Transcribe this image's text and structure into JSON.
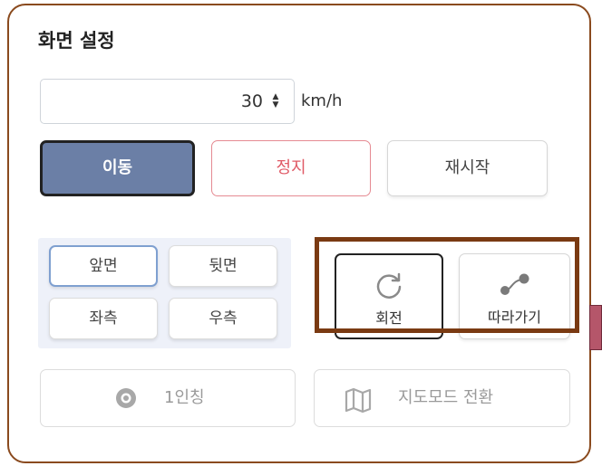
{
  "panel": {
    "title": "화면 설정"
  },
  "speed": {
    "value": "30",
    "unit": "km/h"
  },
  "controls": {
    "move_label": "이동",
    "stop_label": "정지",
    "restart_label": "재시작"
  },
  "view_buttons": {
    "front": "앞면",
    "back": "뒷면",
    "left": "좌측",
    "right": "우측"
  },
  "tools": {
    "rotate_label": "회전",
    "follow_label": "따라가기"
  },
  "disabled_buttons": {
    "first_person_label": "1인칭",
    "map_mode_label": "지도모드 전환"
  },
  "colors": {
    "accent": "#6b7fa6",
    "stop": "#e05a66",
    "highlight_border": "#7a3a12",
    "panel_border": "#8a4a1e"
  }
}
